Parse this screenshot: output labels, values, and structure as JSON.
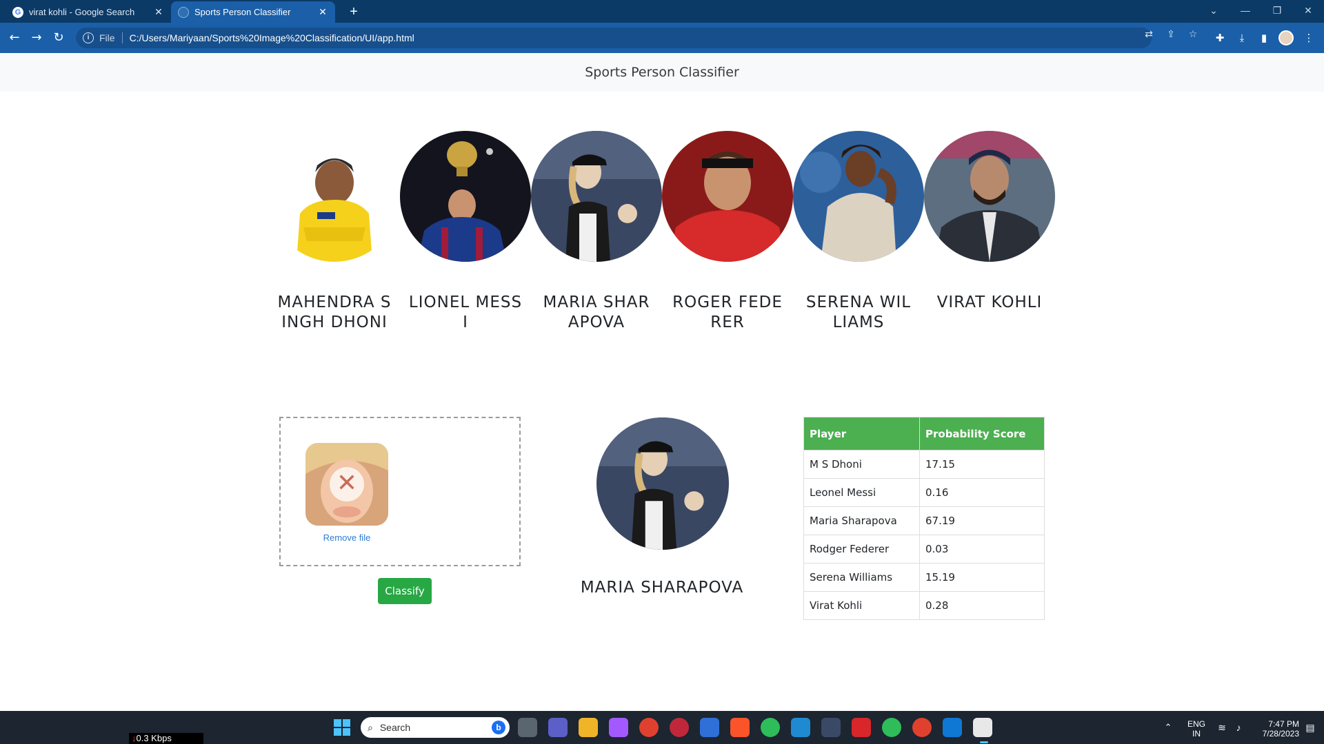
{
  "browser": {
    "tabs": [
      {
        "label": "virat kohli - Google Search",
        "favicon": "G",
        "active": false
      },
      {
        "label": "Sports Person Classifier",
        "active": true
      }
    ],
    "new_tab_icon": "+",
    "url_scheme": "File",
    "url": "C:/Users/Mariyaan/Sports%20Image%20Classification/UI/app.html"
  },
  "page": {
    "title": "Sports Person Classifier",
    "players": [
      {
        "name": "MAHENDRA SINGH DHONI",
        "palette": [
          "#f4f4f4",
          "#f5d11c",
          "#6b4a2c"
        ]
      },
      {
        "name": "LIONEL MESSI",
        "palette": [
          "#1a1a2e",
          "#1c3a8a",
          "#c9a440"
        ]
      },
      {
        "name": "MARIA SHARAPOVA",
        "palette": [
          "#2a3550",
          "#e5cfb5",
          "#1a1a1a"
        ]
      },
      {
        "name": "ROGER FEDERER",
        "palette": [
          "#8a1a1a",
          "#d72a2a",
          "#c9936f"
        ]
      },
      {
        "name": "SERENA WILLIAMS",
        "palette": [
          "#2d5f9a",
          "#dcd2c2",
          "#6b3e26"
        ]
      },
      {
        "name": "VIRAT KOHLI",
        "palette": [
          "#5c6e80",
          "#2b2f38",
          "#b88a6d"
        ]
      }
    ],
    "upload": {
      "remove_label": "Remove file",
      "classify_label": "Classify"
    },
    "result": {
      "name": "MARIA SHARAPOVA"
    },
    "table": {
      "headers": [
        "Player",
        "Probability Score"
      ],
      "rows": [
        [
          "M S Dhoni",
          "17.15"
        ],
        [
          "Leonel Messi",
          "0.16"
        ],
        [
          "Maria Sharapova",
          "67.19"
        ],
        [
          "Rodger Federer",
          "0.03"
        ],
        [
          "Serena Williams",
          "15.19"
        ],
        [
          "Virat Kohli",
          "0.28"
        ]
      ]
    }
  },
  "taskbar": {
    "net_speed": "0.3 Kbps",
    "search_placeholder": "Search",
    "lang": "ENG",
    "region": "IN",
    "time": "7:47 PM",
    "date": "7/28/2023"
  }
}
